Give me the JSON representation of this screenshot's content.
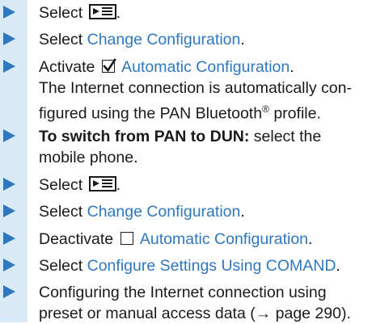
{
  "colors": {
    "accent": "#2f78bf",
    "text": "#1a1a1a",
    "margin_band": "#dbeaf7"
  },
  "icons": {
    "step_marker": "right-triangle-arrow",
    "menu": "menu-icon",
    "checked": "checkbox-checked-icon",
    "unchecked": "checkbox-unchecked-icon"
  },
  "steps": [
    {
      "prefix": "Select",
      "suffix": "."
    },
    {
      "prefix": "Select ",
      "link": "Change Configuration",
      "suffix": "."
    },
    {
      "prefix": "Activate",
      "link": "Automatic Configuration",
      "suffix": ".",
      "note_line1": "The Internet connection is automatically con-",
      "note_line2_a": "figured using the PAN Bluetooth",
      "note_sup": "®",
      "note_line2_b": " profile."
    },
    {
      "bold": "To switch from PAN to DUN:",
      "line1_rest": " select the",
      "line2": "mobile phone."
    },
    {
      "prefix": "Select",
      "suffix": "."
    },
    {
      "prefix": "Select ",
      "link": "Change Configuration",
      "suffix": "."
    },
    {
      "prefix": "Deactivate",
      "link": "Automatic Configuration",
      "suffix": "."
    },
    {
      "prefix": "Select ",
      "link": "Configure Settings Using COMAND",
      "suffix": "."
    },
    {
      "line1": "Configuring the Internet connection using",
      "line2": "preset or manual access data (→ page 290)."
    }
  ]
}
